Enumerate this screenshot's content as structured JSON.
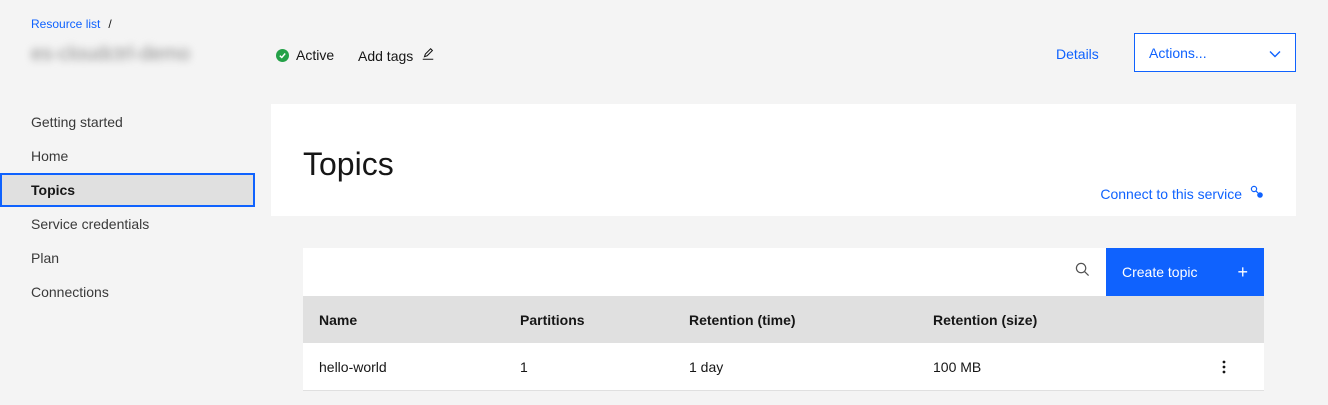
{
  "breadcrumb": {
    "link": "Resource list",
    "separator": "/"
  },
  "service": {
    "name": "es-cloudctrl-demo",
    "status": "Active",
    "add_tags": "Add tags"
  },
  "header": {
    "details": "Details",
    "actions": "Actions..."
  },
  "sidebar": {
    "items": [
      {
        "label": "Getting started"
      },
      {
        "label": "Home"
      },
      {
        "label": "Topics"
      },
      {
        "label": "Service credentials"
      },
      {
        "label": "Plan"
      },
      {
        "label": "Connections"
      }
    ]
  },
  "main": {
    "title": "Topics",
    "connect": "Connect to this service",
    "search": {
      "placeholder": ""
    },
    "create_button": "Create topic",
    "table": {
      "columns": [
        "Name",
        "Partitions",
        "Retention (time)",
        "Retention (size)"
      ],
      "rows": [
        {
          "name": "hello-world",
          "partitions": "1",
          "retention_time": "1 day",
          "retention_size": "100 MB"
        }
      ]
    }
  },
  "colors": {
    "accent": "#0f62fe",
    "success": "#24a148",
    "background": "#f4f4f4"
  }
}
